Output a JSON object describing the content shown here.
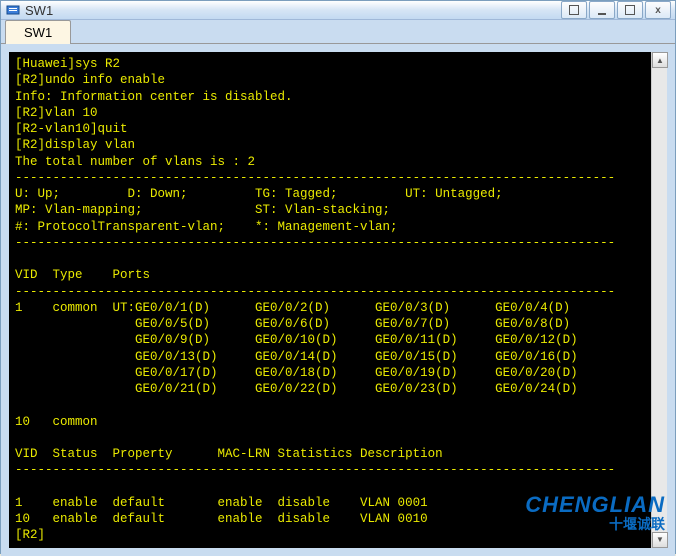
{
  "window": {
    "title": "SW1"
  },
  "tab": {
    "label": "SW1"
  },
  "terminal": {
    "lines": [
      "[Huawei]sys R2",
      "[R2]undo info enable",
      "Info: Information center is disabled.",
      "[R2]vlan 10",
      "[R2-vlan10]quit",
      "[R2]display vlan",
      "The total number of vlans is : 2",
      "--------------------------------------------------------------------------------",
      "U: Up;         D: Down;         TG: Tagged;         UT: Untagged;",
      "MP: Vlan-mapping;               ST: Vlan-stacking;",
      "#: ProtocolTransparent-vlan;    *: Management-vlan;",
      "--------------------------------------------------------------------------------",
      "",
      "VID  Type    Ports",
      "--------------------------------------------------------------------------------",
      "1    common  UT:GE0/0/1(D)      GE0/0/2(D)      GE0/0/3(D)      GE0/0/4(D)",
      "                GE0/0/5(D)      GE0/0/6(D)      GE0/0/7(D)      GE0/0/8(D)",
      "                GE0/0/9(D)      GE0/0/10(D)     GE0/0/11(D)     GE0/0/12(D)",
      "                GE0/0/13(D)     GE0/0/14(D)     GE0/0/15(D)     GE0/0/16(D)",
      "                GE0/0/17(D)     GE0/0/18(D)     GE0/0/19(D)     GE0/0/20(D)",
      "                GE0/0/21(D)     GE0/0/22(D)     GE0/0/23(D)     GE0/0/24(D)",
      "",
      "10   common",
      "",
      "VID  Status  Property      MAC-LRN Statistics Description",
      "--------------------------------------------------------------------------------",
      "",
      "1    enable  default       enable  disable    VLAN 0001",
      "10   enable  default       enable  disable    VLAN 0010",
      "[R2]"
    ]
  },
  "watermark": {
    "main": "CHENGLIAN",
    "sub": "十堰诚联"
  }
}
